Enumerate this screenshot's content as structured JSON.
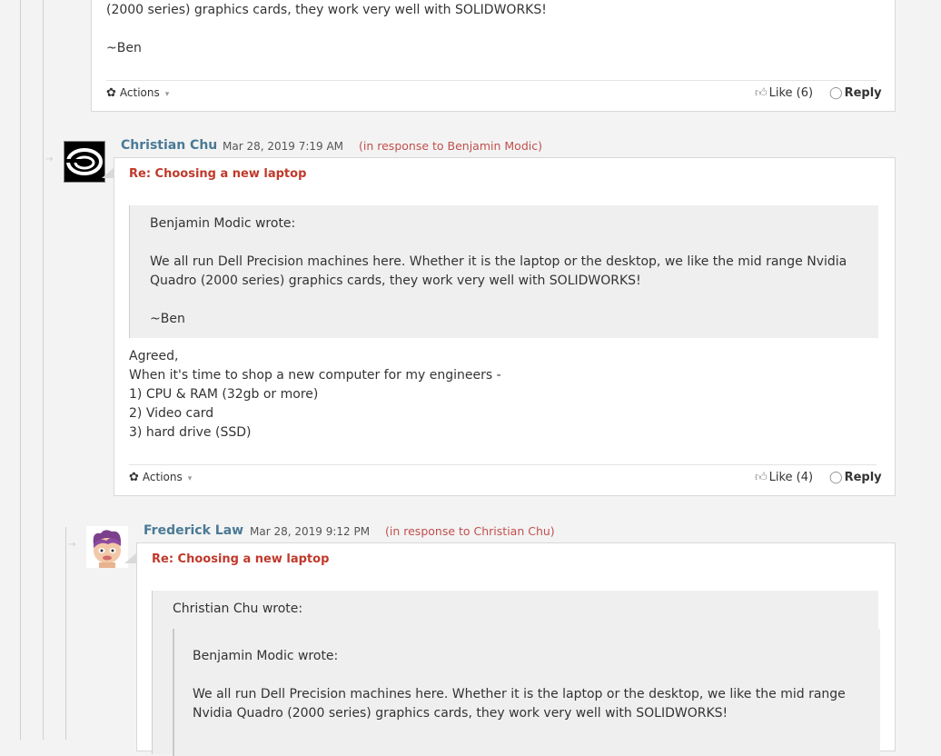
{
  "post1": {
    "text_line": "(2000 series) graphics cards, they work very well with SOLIDWORKS!",
    "signature": "~Ben",
    "actions_label": "Actions",
    "like_label": "Like (6)",
    "reply_label": "Reply"
  },
  "post2": {
    "author": "Christian Chu",
    "date": "Mar 28, 2019 7:19 AM",
    "in_response": "(in response to Benjamin Modic)",
    "subject": "Re: Choosing a new laptop",
    "quote": {
      "header": "Benjamin Modic wrote:",
      "lines": [
        "We all run Dell Precision machines here. Whether it is the laptop or the desktop, we like the mid range Nvidia",
        "Quadro (2000 series) graphics cards, they work very well with SOLIDWORKS!"
      ],
      "signature": "~Ben"
    },
    "body": [
      "Agreed,",
      "When it's time to shop a new computer for my engineers -",
      "1) CPU & RAM (32gb or more)",
      "2) Video card",
      "3) hard drive (SSD)"
    ],
    "actions_label": "Actions",
    "like_label": "Like (4)",
    "reply_label": "Reply"
  },
  "post3": {
    "author": "Frederick Law",
    "date": "Mar 28, 2019 9:12 PM",
    "in_response": "(in response to Christian Chu)",
    "subject": "Re: Choosing a new laptop",
    "quote": {
      "header": "Christian Chu wrote:",
      "inner": {
        "header": "Benjamin Modic wrote:",
        "lines": [
          "We all run Dell Precision machines here. Whether it is the laptop or the desktop, we like the mid range",
          "Nvidia Quadro (2000 series) graphics cards, they work very well with SOLIDWORKS!"
        ]
      }
    }
  },
  "icons": {
    "gear": "gear-icon",
    "like": "thumbs-up-icon",
    "reply": "speech-bubble-icon",
    "caret": "caret-down-icon",
    "thread_arrow": "thread-arrow-icon"
  },
  "colors": {
    "author": "#4a7a96",
    "in_response": "#c0504d",
    "subject": "#c0392b",
    "quote_bg": "#efefef",
    "page_bg": "#f3f3f3"
  }
}
